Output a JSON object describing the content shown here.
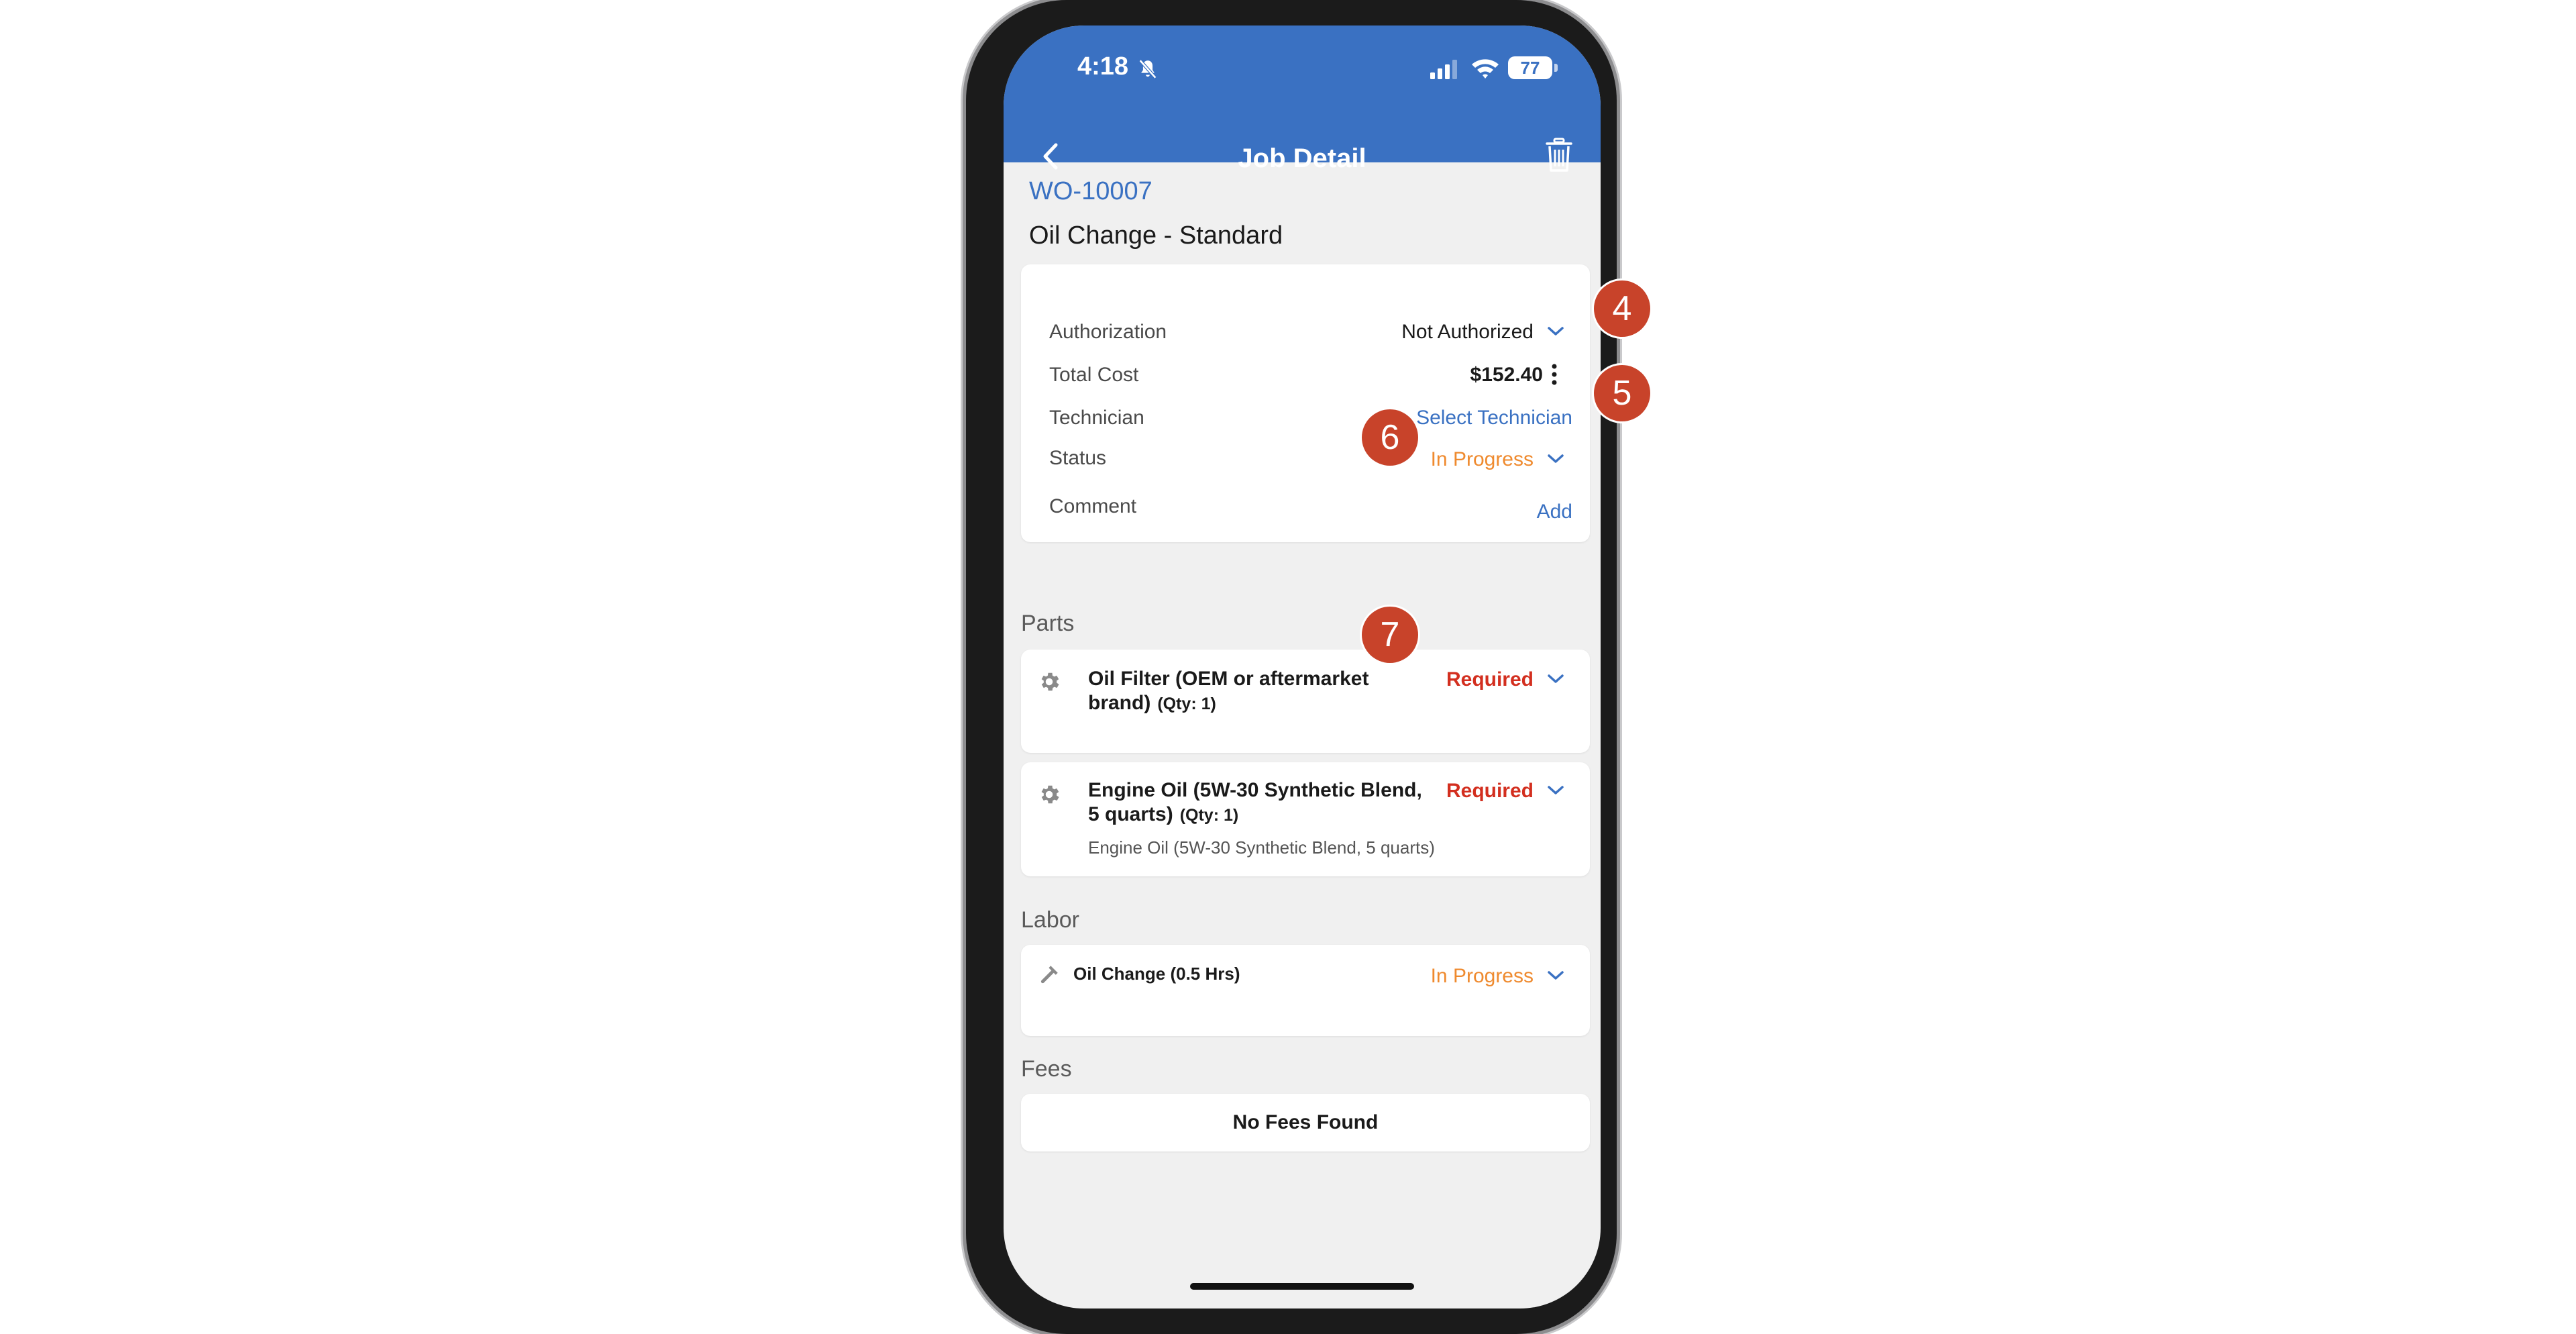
{
  "status_bar": {
    "time": "4:18",
    "battery": "77"
  },
  "header": {
    "title": "Job Detail"
  },
  "job": {
    "wo_number": "WO-10007",
    "title": "Oil Change - Standard"
  },
  "details": {
    "authorization_label": "Authorization",
    "authorization_value": "Not Authorized",
    "total_cost_label": "Total Cost",
    "total_cost_value": "$152.40",
    "technician_label": "Technician",
    "technician_value": "Select Technician",
    "status_label": "Status",
    "status_value": "In Progress",
    "comment_label": "Comment",
    "comment_action": "Add"
  },
  "parts": {
    "section_title": "Parts",
    "items": [
      {
        "name": "Oil Filter (OEM or aftermarket brand)",
        "qty": "(Qty: 1)",
        "status": "Required",
        "description": ""
      },
      {
        "name": "Engine Oil (5W-30 Synthetic Blend, 5 quarts)",
        "qty": "(Qty: 1)",
        "status": "Required",
        "description": "Engine Oil (5W-30 Synthetic Blend, 5 quarts)"
      }
    ]
  },
  "labor": {
    "section_title": "Labor",
    "items": [
      {
        "name": "Oil Change (0.5 Hrs)",
        "status": "In Progress"
      }
    ]
  },
  "fees": {
    "section_title": "Fees",
    "empty_text": "No Fees Found"
  },
  "callouts": [
    "4",
    "5",
    "6",
    "7"
  ],
  "colors": {
    "header_blue": "#3a71c2",
    "required_red": "#d32f1f",
    "progress_orange": "#ef8a2e",
    "callout_red": "#c8432a"
  }
}
